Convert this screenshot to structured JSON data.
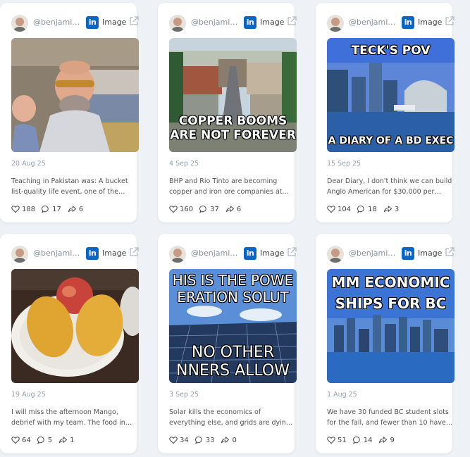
{
  "posts": [
    {
      "author": "@benjamin...",
      "type": "Image",
      "date": "20 Aug 25",
      "excerpt": "Teaching in Pakistan was: A bucket list-quality life event, one of the most...",
      "likes": "188",
      "comments": "17",
      "shares": "6",
      "image": {
        "kind": "photo-selfie"
      }
    },
    {
      "author": "@benjamin...",
      "type": "Image",
      "date": "4 Sep 25",
      "excerpt": "BHP and Rio Tinto are becoming copper and iron ore companies at...",
      "likes": "160",
      "comments": "37",
      "shares": "6",
      "image": {
        "kind": "meme-town",
        "caption_lines": [
          "COPPER BOOMS",
          "ARE NOT FOREVER"
        ]
      }
    },
    {
      "author": "@benjamin...",
      "type": "Image",
      "date": "15 Sep 25",
      "excerpt": "Dear Diary, I don't think we can build Anglo American for $30,000 per tonne...",
      "likes": "104",
      "comments": "18",
      "shares": "3",
      "image": {
        "kind": "meme-city",
        "top_text": "TECK'S POV",
        "bottom_text": "A DIARY OF A BD EXEC"
      }
    },
    {
      "author": "@benjamin...",
      "type": "Image",
      "date": "19 Aug 25",
      "excerpt": "I will miss the afternoon Mango, debrief with my team. The food in Pakistan is...",
      "likes": "64",
      "comments": "5",
      "shares": "1",
      "image": {
        "kind": "photo-fruit"
      }
    },
    {
      "author": "@benjamin...",
      "type": "Image",
      "date": "3 Sep 25",
      "excerpt": "Solar kills the economics of everything else, and grids are dying because of i...",
      "likes": "34",
      "comments": "33",
      "shares": "0",
      "image": {
        "kind": "meme-solar",
        "top_lines": [
          "HIS IS THE POWE",
          "ERATION SOLUT"
        ],
        "bottom_lines": [
          "NO OTHER",
          "NNERS ALLOW"
        ]
      }
    },
    {
      "author": "@benjamin...",
      "type": "Image",
      "date": "1 Aug 25",
      "excerpt": "We have 30 funded BC student slots for the fall, and fewer than 10 have...",
      "likes": "51",
      "comments": "14",
      "shares": "9",
      "image": {
        "kind": "meme-skyline",
        "top_lines": [
          "MM ECONOMIC",
          "SHIPS FOR BC"
        ]
      }
    }
  ],
  "icons": {
    "network": "linkedin-icon",
    "open": "external-link-icon",
    "likes": "heart-icon",
    "comments": "comment-icon",
    "shares": "share-icon"
  },
  "colors": {
    "page_bg": "#eef1f5",
    "card_bg": "#ffffff",
    "linkedin": "#0a66c2",
    "muted": "#9aa0a8"
  }
}
